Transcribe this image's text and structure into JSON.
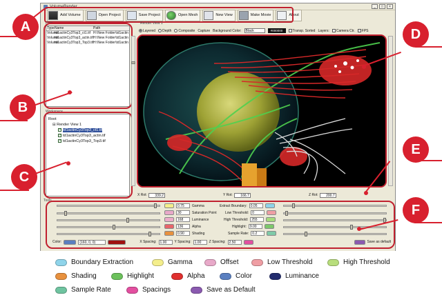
{
  "window": {
    "title": "VolumeRender"
  },
  "toolbar": {
    "buttons": [
      {
        "label": "Add Volume",
        "icon": "database-icon"
      },
      {
        "label": "Open Project",
        "icon": "folder-icon"
      },
      {
        "label": "Save Project",
        "icon": "save-icon"
      },
      {
        "label": "Open Mesh",
        "icon": "mesh-icon"
      },
      {
        "label": "New View",
        "icon": "view-icon"
      },
      {
        "label": "Make Movie",
        "icon": "movie-icon"
      },
      {
        "label": "About",
        "icon": "about-icon"
      }
    ]
  },
  "data_panel": {
    "label": "Data",
    "columns": [
      "Type",
      "Name",
      "Path"
    ],
    "rows": [
      [
        "Volume",
        "td1actinCy3Top3_ct1.tif",
        "H:\\New Folder\\td1actin"
      ],
      [
        "Volume",
        "td1actinCy3Top3_actin.tif",
        "H:\\New Folder\\td1actin"
      ],
      [
        "Volume",
        "td1actinCy3Top3_Top3.tif",
        "H:\\New Folder\\td1actin"
      ]
    ]
  },
  "tree_panel": {
    "label": "Workspace",
    "root": "Root",
    "view": "Render View 1",
    "items": [
      "td1actinCy3Top3_ct1.tif",
      "td1actinCy3Top3_actin.tif",
      "td1actinCy3Top3_Top3.tif"
    ]
  },
  "render_view": {
    "label": "Render View 1",
    "options": [
      "Layered",
      "Depth",
      "Composite",
      "Capture"
    ],
    "bg_label": "Background Color:",
    "bg_value": "Black",
    "bg_hex": "#000000",
    "toggles": [
      "Transp. Sorted",
      "Layers:",
      "Camera Ctr.",
      "FPS"
    ]
  },
  "coords": {
    "x_label": "X Rot:",
    "x_value": "339.2",
    "y_label": "Y Rot:",
    "y_value": "166.7",
    "z_label": "Z Rot:",
    "z_value": "200.7"
  },
  "tools": {
    "label": "Tools",
    "left_params": [
      {
        "value": "0.75",
        "name": "Gamma",
        "color": "#f4ee8c"
      },
      {
        "value": "30",
        "name": "Saturation Point",
        "color": "#e8a9c9"
      },
      {
        "value": "168",
        "name": "Luminance",
        "color": "#ecacca"
      },
      {
        "value": "136",
        "name": "Alpha",
        "color": "#e8656a"
      },
      {
        "value": "0.90",
        "name": "Shading",
        "color": "#e8913e"
      }
    ],
    "right_params": [
      {
        "name": "Extract Boundary:",
        "value": "0.05",
        "color": "#8fd4ea"
      },
      {
        "name": "Low Threshold:",
        "value": "0",
        "color": "#ef9ea4"
      },
      {
        "name": "High Threshold:",
        "value": "255",
        "color": "#a6db7c"
      },
      {
        "name": "Highlight:",
        "value": "9.00",
        "color": "#7dc86a"
      },
      {
        "name": "Sample Rate:",
        "value": "0.2",
        "color": "#7fcaa8"
      }
    ],
    "color_label": "Color:",
    "color_value": "(160, 0, 0)",
    "x_spacing_label": "X Spacing:",
    "x_spacing": "1.00",
    "y_spacing_label": "Y Spacing:",
    "y_spacing": "1.00",
    "z_spacing_label": "Z Spacing:",
    "z_spacing": "2.50",
    "save_default": "Save as default"
  },
  "legend": [
    {
      "label": "Boundary Extraction",
      "color": "#8fd4ea"
    },
    {
      "label": "Gamma",
      "color": "#f4ee8c"
    },
    {
      "label": "Offset",
      "color": "#e8a9c9"
    },
    {
      "label": "Low Threshold",
      "color": "#ef9ea4"
    },
    {
      "label": "High Threshold",
      "color": "#b8de7c"
    },
    {
      "label": "Shading",
      "color": "#e8913e"
    },
    {
      "label": "Highlight",
      "color": "#6cc15c"
    },
    {
      "label": "Alpha",
      "color": "#e0302f"
    },
    {
      "label": "Color",
      "color": "#5a7fc0"
    },
    {
      "label": "Luminance",
      "color": "#232c6e"
    },
    {
      "label": "Sample Rate",
      "color": "#6fc4a0"
    },
    {
      "label": "Spacings",
      "color": "#e34fa0"
    },
    {
      "label": "Save as Default",
      "color": "#8b5ab0"
    }
  ],
  "callouts": [
    "A",
    "B",
    "C",
    "D",
    "E",
    "F"
  ]
}
